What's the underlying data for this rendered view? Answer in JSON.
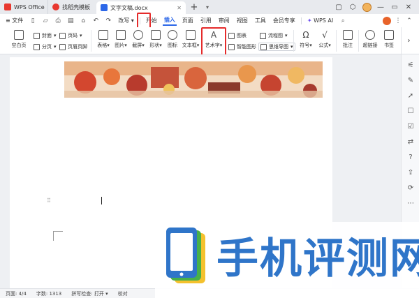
{
  "tabs": [
    {
      "label": "WPS Office",
      "icon": "wps-logo-icon",
      "color": "#e8382f"
    },
    {
      "label": "找稻壳模板",
      "icon": "docer-icon",
      "color": "#e8382f"
    },
    {
      "label": "文字文稿.docx",
      "icon": "writer-doc-icon",
      "color": "#2c67e8"
    }
  ],
  "menu": {
    "file": "文件",
    "zoom_label": "改写",
    "items": [
      "开始",
      "插入",
      "页面",
      "引用",
      "审阅",
      "视图",
      "工具",
      "会员专享"
    ],
    "ai": "WPS AI",
    "active": "插入"
  },
  "ribbon": {
    "blank_page": "空白页",
    "cover": "封面",
    "section": "分页",
    "page_number": "页码",
    "header_footer": "页眉页脚",
    "table": "表格",
    "picture": "图片",
    "screenshot": "截屏",
    "shape": "形状",
    "icons": "图标",
    "textbox": "文本框",
    "wordart": "艺术字",
    "chart": "图表",
    "smart_graphic": "智能图形",
    "flowchart": "流程图",
    "mindmap": "思维导图",
    "symbol": "符号",
    "formula": "公式",
    "comment": "批注",
    "hyperlink": "超链接",
    "bookmark": "书签"
  },
  "status": {
    "page": "页面: 4/4",
    "words": "字数: 1313",
    "spellcheck": "拼写检查: 打开",
    "proofread": "校对"
  },
  "watermark": {
    "text": "手机评测网",
    "color": "#2f75c9"
  },
  "colors": {
    "accent": "#2c67e8",
    "highlight_box": "#e52b2b"
  }
}
